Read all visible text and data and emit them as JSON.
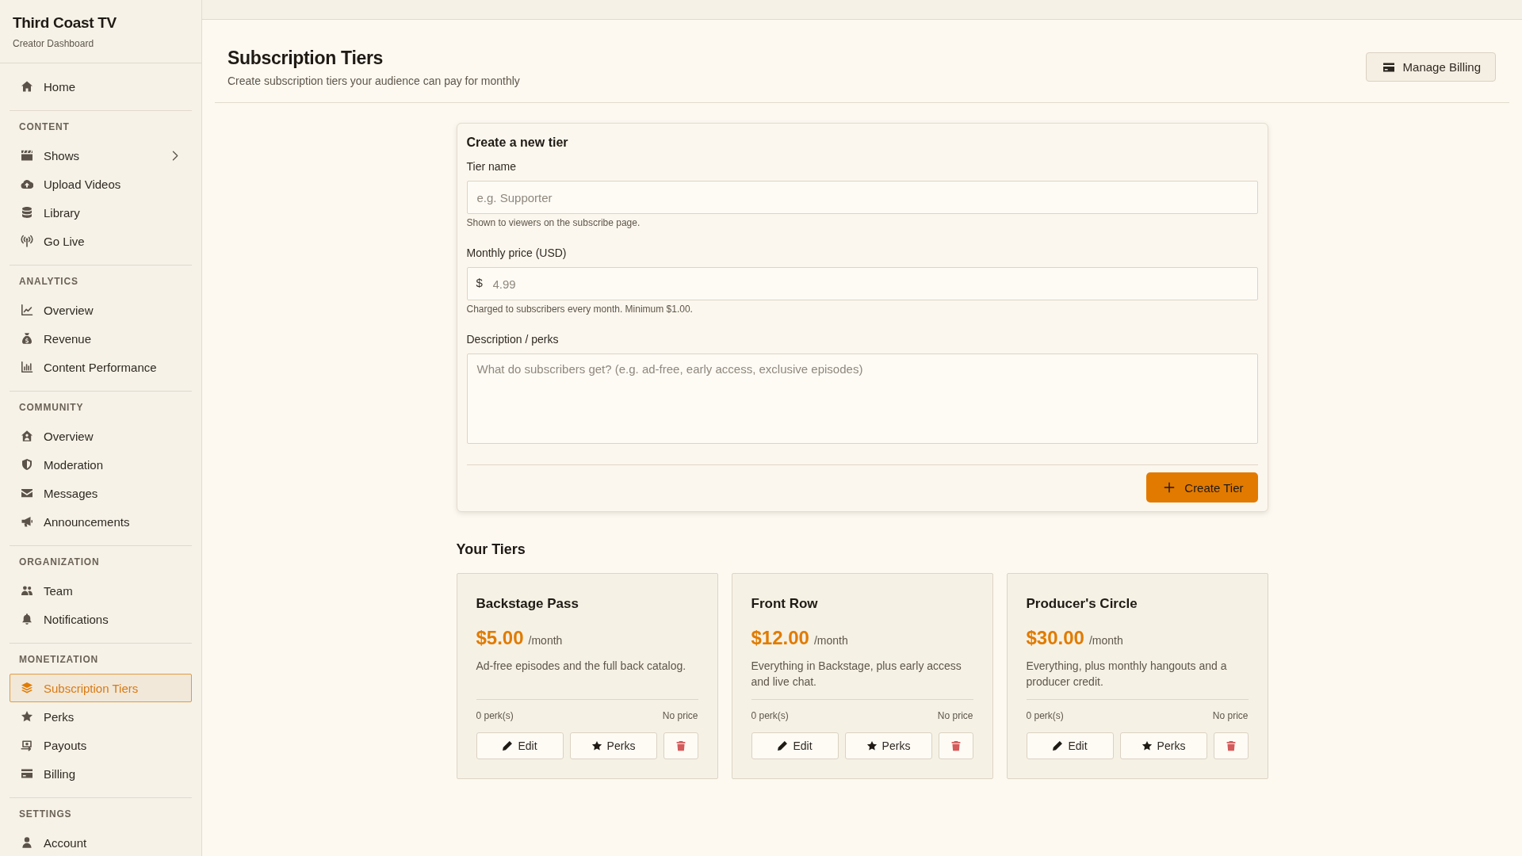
{
  "sidebar": {
    "title": "Third Coast TV",
    "subtitle": "Creator Dashboard",
    "sections": [
      {
        "items": [
          {
            "label": "Home",
            "selected": false
          }
        ]
      },
      {
        "heading": "CONTENT",
        "items": [
          {
            "label": "Shows",
            "selected": false,
            "expanded": false
          },
          {
            "label": "Upload Videos",
            "selected": false
          },
          {
            "label": "Library",
            "selected": false
          },
          {
            "label": "Go Live",
            "selected": false
          }
        ]
      },
      {
        "heading": "ANALYTICS",
        "items": [
          {
            "label": "Overview",
            "selected": false
          },
          {
            "label": "Revenue",
            "selected": false
          },
          {
            "label": "Content Performance",
            "selected": false
          }
        ]
      },
      {
        "heading": "COMMUNITY",
        "items": [
          {
            "label": "Overview",
            "selected": false
          },
          {
            "label": "Moderation",
            "selected": false
          },
          {
            "label": "Messages",
            "selected": false
          },
          {
            "label": "Announcements",
            "selected": false
          }
        ]
      },
      {
        "heading": "ORGANIZATION",
        "items": [
          {
            "label": "Team",
            "selected": false
          },
          {
            "label": "Notifications",
            "selected": false
          }
        ]
      },
      {
        "heading": "MONETIZATION",
        "items": [
          {
            "label": "Subscription Tiers",
            "selected": true
          },
          {
            "label": "Perks",
            "selected": false
          },
          {
            "label": "Payouts",
            "selected": false
          },
          {
            "label": "Billing",
            "selected": false
          }
        ]
      },
      {
        "heading": "SETTINGS",
        "items": [
          {
            "label": "Account",
            "selected": false
          }
        ]
      }
    ]
  },
  "header": {
    "title": "Subscription Tiers",
    "subtitle": "Create subscription tiers your audience can pay for monthly",
    "action": "Manage Billing"
  },
  "form": {
    "title": "Create a new tier",
    "fields": [
      {
        "kind": "text",
        "label": "Tier name",
        "placeholder": "e.g. Supporter",
        "help": "Shown to viewers on the subscribe page."
      },
      {
        "kind": "price",
        "label": "Monthly price (USD)",
        "prefix": "$",
        "placeholder": "4.99",
        "help": "Charged to subscribers every month. Minimum $1.00."
      },
      {
        "kind": "textarea",
        "label": "Description / perks",
        "placeholder": "What do subscribers get? (e.g. ad-free, early access, exclusive episodes)"
      }
    ],
    "submit": "Create Tier"
  },
  "tiers": {
    "title": "Your Tiers",
    "items": [
      {
        "name": "Backstage Pass",
        "price": "$5.00",
        "period": "/month",
        "description": "Ad-free episodes and the full back catalog.",
        "perk_count": "0 perk(s)",
        "price_status": "No price",
        "edit_label": "Edit",
        "perks_label": "Perks"
      },
      {
        "name": "Front Row",
        "price": "$12.00",
        "period": "/month",
        "description": "Everything in Backstage, plus early access and live chat.",
        "perk_count": "0 perk(s)",
        "price_status": "No price",
        "edit_label": "Edit",
        "perks_label": "Perks"
      },
      {
        "name": "Producer's Circle",
        "price": "$30.00",
        "period": "/month",
        "description": "Everything, plus monthly hangouts and a producer credit.",
        "perk_count": "0 perk(s)",
        "price_status": "No price",
        "edit_label": "Edit",
        "perks_label": "Perks"
      }
    ]
  }
}
